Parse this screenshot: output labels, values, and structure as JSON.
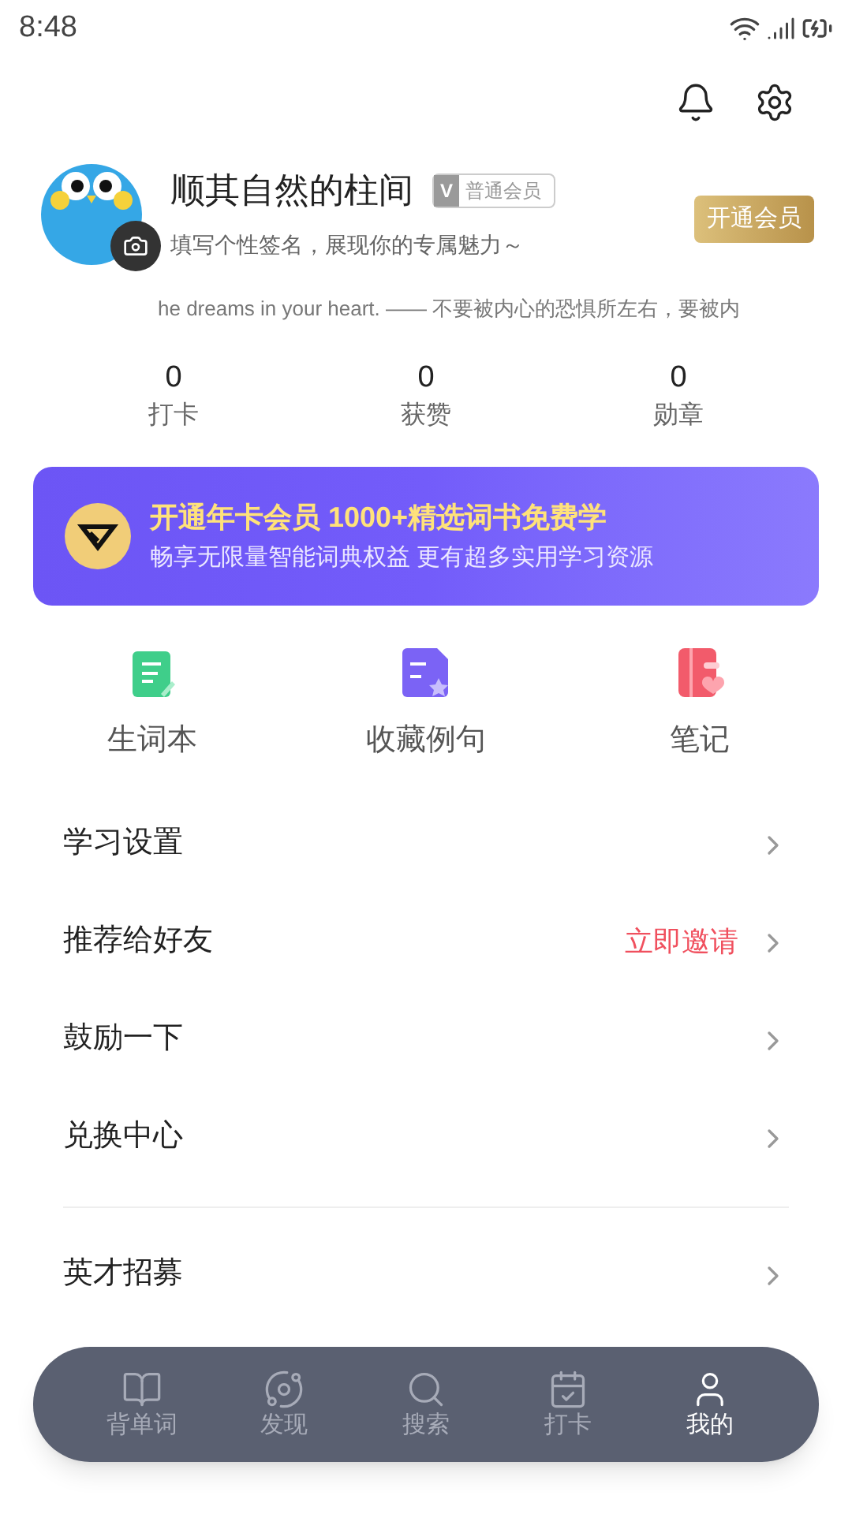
{
  "status_bar": {
    "time": "8:48"
  },
  "profile": {
    "name": "顺其自然的柱间",
    "badge_icon": "V",
    "badge": "普通会员",
    "signature": "填写个性签名，展现你的专属魅力～",
    "vip_button": "开通会员",
    "quote": "he dreams in your heart. —— 不要被内心的恐惧所左右，要被内"
  },
  "stats": [
    {
      "value": "0",
      "label": "打卡"
    },
    {
      "value": "0",
      "label": "获赞"
    },
    {
      "value": "0",
      "label": "勋章"
    }
  ],
  "banner": {
    "title": "开通年卡会员 1000+精选词书免费学",
    "subtitle": "畅享无限量智能词典权益 更有超多实用学习资源"
  },
  "shortcuts": [
    {
      "kind": "wordbook",
      "label": "生词本"
    },
    {
      "kind": "favorites",
      "label": "收藏例句"
    },
    {
      "kind": "notes",
      "label": "笔记"
    }
  ],
  "menu": [
    {
      "label": "学习设置"
    },
    {
      "label": "推荐给好友",
      "action": "立即邀请"
    },
    {
      "label": "鼓励一下"
    },
    {
      "label": "兑换中心"
    },
    {
      "kind": "divider"
    },
    {
      "label": "英才招募"
    }
  ],
  "tab_bar": [
    {
      "kind": "book",
      "label": "背单词",
      "selected": false
    },
    {
      "kind": "planet",
      "label": "发现",
      "selected": false
    },
    {
      "kind": "search",
      "label": "搜索",
      "selected": false
    },
    {
      "kind": "calendar",
      "label": "打卡",
      "selected": false
    },
    {
      "kind": "user",
      "label": "我的",
      "selected": true
    }
  ]
}
